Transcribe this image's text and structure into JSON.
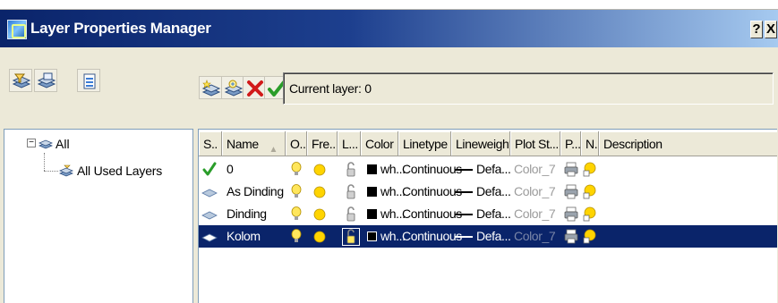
{
  "window": {
    "title": "Layer Properties Manager",
    "help_glyph": "?",
    "close_glyph": "X"
  },
  "toolbar_left": {
    "buttons": [
      "new-property-filter-icon",
      "new-group-filter-icon",
      "layer-states-manager-icon"
    ]
  },
  "toolbar_right": {
    "buttons": [
      "new-layer-icon",
      "new-layer-vp-frozen-icon",
      "delete-layer-icon",
      "set-current-icon"
    ],
    "current_layer": "Current layer: 0"
  },
  "tree": {
    "toggle": "−",
    "root": "All",
    "child": "All Used Layers"
  },
  "grid": {
    "columns": [
      "S..",
      "Name",
      "O..",
      "Fre...",
      "L...",
      "Color",
      "Linetype",
      "Lineweight",
      "Plot St...",
      "P...",
      "N..",
      "Description"
    ],
    "sort_indicator": "▲",
    "rows": [
      {
        "name": "0",
        "color": "wh...",
        "linetype": "Continuous",
        "lineweight": "Defa...",
        "plot_style": "Color_7",
        "status": "current",
        "selected": false
      },
      {
        "name": "As Dinding",
        "color": "wh...",
        "linetype": "Continuous",
        "lineweight": "Defa...",
        "plot_style": "Color_7",
        "status": "layer",
        "selected": false
      },
      {
        "name": "Dinding",
        "color": "wh...",
        "linetype": "Continuous",
        "lineweight": "Defa...",
        "plot_style": "Color_7",
        "status": "layer",
        "selected": false
      },
      {
        "name": "Kolom",
        "color": "wh...",
        "linetype": "Continuous",
        "lineweight": "Defa...",
        "plot_style": "Color_7",
        "status": "layer",
        "selected": true
      }
    ]
  },
  "colors": {
    "titlebar_start": "#0a246a",
    "titlebar_end": "#a6caf0",
    "selection": "#0a246a",
    "current_check": "#2a9d2a",
    "bulb_on": "#ffe65c",
    "sun": "#ffd400"
  }
}
